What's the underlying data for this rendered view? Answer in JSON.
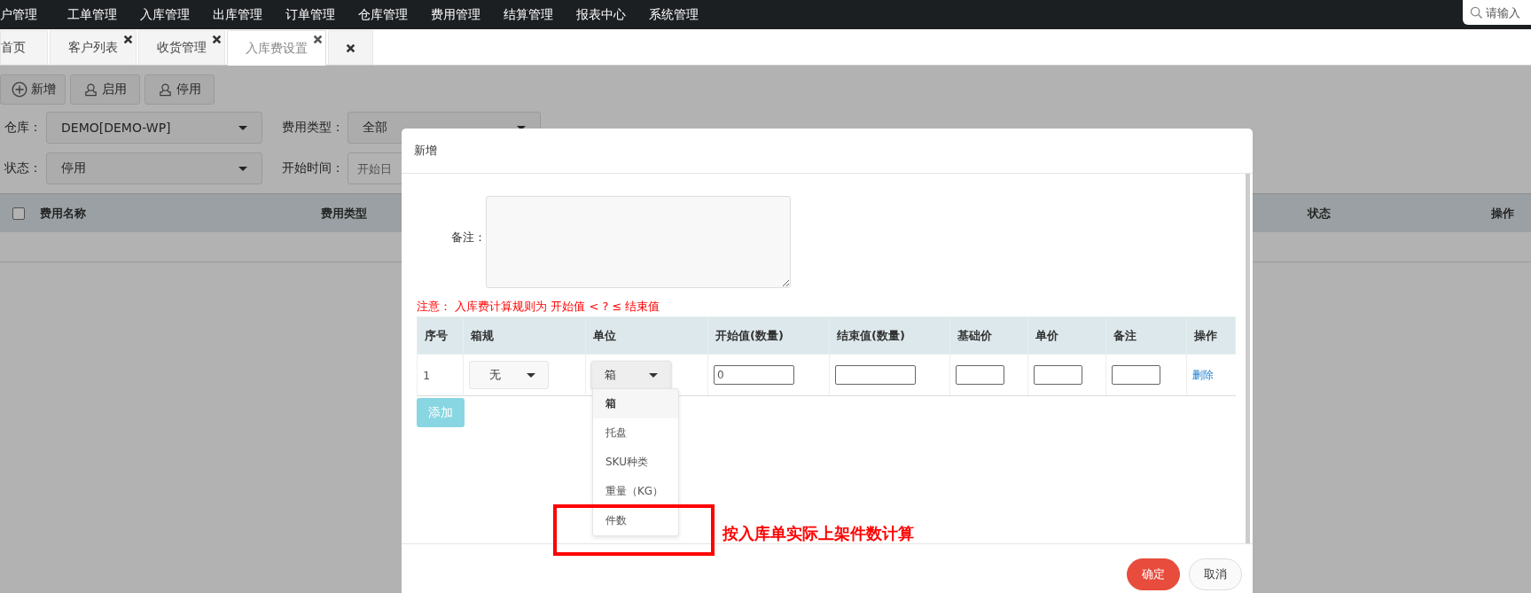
{
  "nav": {
    "items": [
      "户管理",
      "工单管理",
      "入库管理",
      "出库管理",
      "订单管理",
      "仓库管理",
      "费用管理",
      "结算管理",
      "报表中心",
      "系统管理"
    ],
    "search": {
      "placeholder": "请输入"
    }
  },
  "tabs": [
    {
      "label": "首页",
      "closable": false,
      "selected": false
    },
    {
      "label": "客户列表",
      "closable": true,
      "selected": false
    },
    {
      "label": "收货管理",
      "closable": true,
      "selected": false
    },
    {
      "label": "入库费设置",
      "closable": true,
      "selected": true
    },
    {
      "closable": true,
      "selected": false
    }
  ],
  "toolbar": [
    {
      "label": "新增",
      "kind": "add"
    },
    {
      "label": "启用",
      "kind": "enable"
    },
    {
      "label": "停用",
      "kind": "disable"
    }
  ],
  "filters": [
    [
      {
        "label": "仓库：",
        "kind": "select",
        "value": "DEMO[DEMO-WP]"
      },
      {
        "label": "费用类型：",
        "kind": "select",
        "value": "全部"
      }
    ],
    [
      {
        "label": "状态：",
        "kind": "select",
        "value": "停用"
      },
      {
        "label": "开始时间：",
        "kind": "date",
        "placeholder": "开始日"
      }
    ]
  ],
  "table": {
    "select_all": {
      "checked": false
    },
    "columns": [
      "费用名称",
      "费用类型",
      "状态",
      "操作"
    ]
  },
  "modal": {
    "title": "新增",
    "remark_label": "备注：",
    "notice": "注意：  入库费计算规则为 开始值 < ? ≤ 结束值",
    "rules": {
      "columns": [
        "序号",
        "箱规",
        "单位",
        "开始值(数量)",
        "结束值(数量)",
        "基础价",
        "单价",
        "备注",
        "操作"
      ],
      "rows": [
        {
          "index": "1",
          "box_spec": "无",
          "unit": "箱",
          "start_value": "0",
          "action": "删除"
        }
      ]
    },
    "add_button": "添加",
    "unit_options": [
      {
        "label": "箱",
        "selected": true
      },
      {
        "label": "托盘",
        "selected": false
      },
      {
        "label": "SKU种类",
        "selected": false
      },
      {
        "label": "重量（KG）",
        "selected": false
      },
      {
        "label": "件数",
        "selected": false
      }
    ],
    "buttons": [
      {
        "label": "确定",
        "kind": "primary"
      },
      {
        "label": "取消",
        "kind": "default"
      }
    ]
  },
  "annotation": {
    "text": "按入库单实际上架件数计算"
  }
}
